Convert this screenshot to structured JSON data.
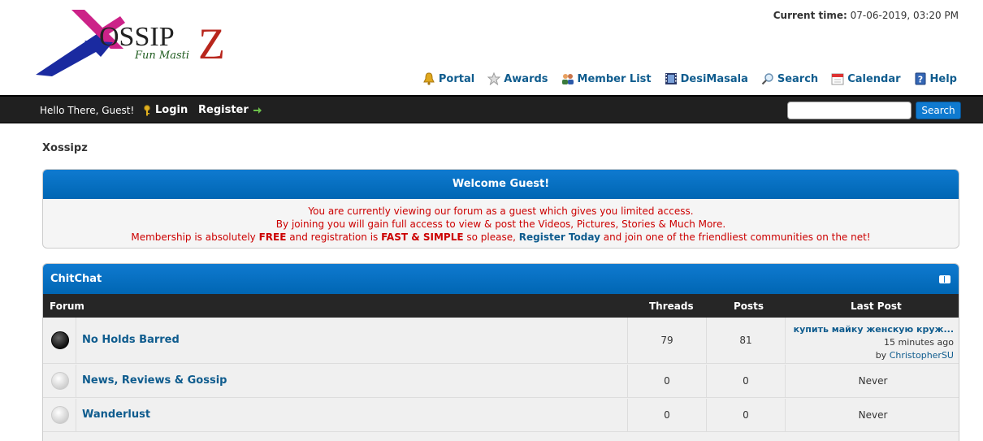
{
  "logo": {
    "brand": "OSSIP",
    "brand_z": "Z",
    "tagline": "Fun Masti"
  },
  "header": {
    "current_time_label": "Current time:",
    "current_time_value": "07-06-2019, 03:20 PM",
    "menu": [
      {
        "label": "Portal",
        "icon": "bell-icon"
      },
      {
        "label": "Awards",
        "icon": "star-icon"
      },
      {
        "label": "Member List",
        "icon": "users-icon"
      },
      {
        "label": "DesiMasala",
        "icon": "film-icon"
      },
      {
        "label": "Search",
        "icon": "magnifier-icon"
      },
      {
        "label": "Calendar",
        "icon": "calendar-icon"
      },
      {
        "label": "Help",
        "icon": "help-icon"
      }
    ]
  },
  "panel": {
    "welcome": "Hello There, Guest!",
    "login": "Login",
    "register": "Register",
    "search_placeholder": "",
    "search_button": "Search"
  },
  "breadcrumb": "Xossipz",
  "welcome_box": {
    "title": "Welcome Guest!",
    "line1": "You are currently viewing our forum as a guest which gives you limited access.",
    "line2": "By joining you will gain full access to view & post the Videos, Pictures, Stories & Much More.",
    "line3_a": "Membership is absolutely ",
    "line3_free": "FREE",
    "line3_b": " and registration is ",
    "line3_fast": "FAST & SIMPLE",
    "line3_c": " so please, ",
    "line3_link": "Register Today",
    "line3_d": " and join one of the friendliest communities on the net!"
  },
  "category": {
    "title": "ChitChat",
    "columns": {
      "forum": "Forum",
      "threads": "Threads",
      "posts": "Posts",
      "last_post": "Last Post"
    },
    "forums": [
      {
        "name": "No Holds Barred",
        "threads": "79",
        "posts": "81",
        "status": "new",
        "last_post_title": "купить майку женскую круж...",
        "last_post_time": "15 minutes ago",
        "last_post_by_label": "by",
        "last_post_by": "ChristopherSU"
      },
      {
        "name": "News, Reviews & Gossip",
        "threads": "0",
        "posts": "0",
        "status": "old",
        "last_post_text": "Never"
      },
      {
        "name": "Wanderlust",
        "threads": "0",
        "posts": "0",
        "status": "old",
        "last_post_text": "Never"
      }
    ]
  },
  "colors": {
    "accent_blue": "#0f7ad0",
    "link_blue": "#0f5c8e",
    "dark_bar": "#202020",
    "warning_red": "#cc0000"
  }
}
